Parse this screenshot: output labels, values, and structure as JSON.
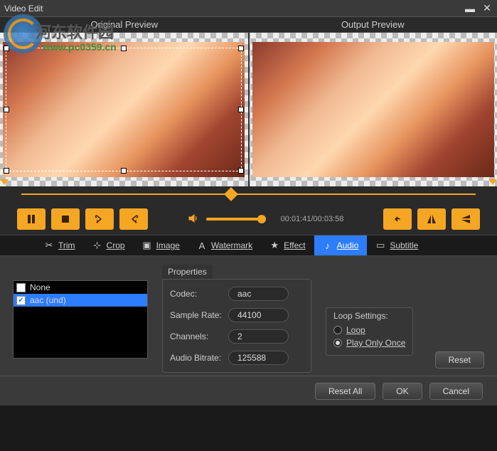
{
  "window": {
    "title": "Video Edit"
  },
  "watermark": {
    "text": "河东软件园",
    "url": "www.pc0359.cn"
  },
  "previews": {
    "original": "Original Preview",
    "output": "Output Preview"
  },
  "playback": {
    "time": "00:01:41/00:03:58"
  },
  "tabs": {
    "trim": "Trim",
    "crop": "Crop",
    "image": "Image",
    "watermark": "Watermark",
    "effect": "Effect",
    "audio": "Audio",
    "subtitle": "Subtitle"
  },
  "tracks": {
    "none": "None",
    "aac": "aac (und)"
  },
  "properties": {
    "title": "Properties",
    "codec_label": "Codec:",
    "codec_value": "aac",
    "samplerate_label": "Sample Rate:",
    "samplerate_value": "44100",
    "channels_label": "Channels:",
    "channels_value": "2",
    "bitrate_label": "Audio Bitrate:",
    "bitrate_value": "125588"
  },
  "loop": {
    "title": "Loop Settings:",
    "loop_label": "Loop",
    "once_label": "Play Only Once"
  },
  "buttons": {
    "reset": "Reset",
    "reset_all": "Reset All",
    "ok": "OK",
    "cancel": "Cancel"
  }
}
